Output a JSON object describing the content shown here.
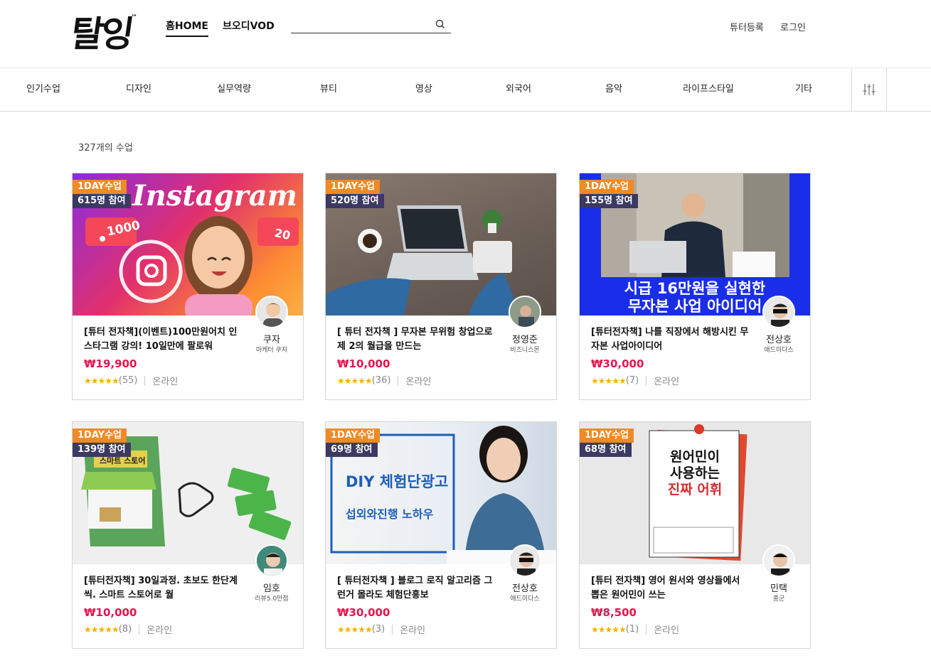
{
  "header": {
    "logo": "탈잉",
    "logo_tm": "™",
    "nav_home": "홈HOME",
    "nav_vod": "브오디VOD",
    "search_placeholder": "",
    "tutor_register": "튜터등록",
    "login": "로그인"
  },
  "categories": [
    "인기수업",
    "디자인",
    "실무역량",
    "뷰티",
    "영상",
    "외국어",
    "음악",
    "라이프스타일",
    "기타"
  ],
  "course_count": "327개의 수업",
  "cards": [
    {
      "badge_day": "1DAY수업",
      "participants": "615명 참여",
      "title": "[튜터 전자책](이벤트)100만원어치 인스타그램 강의! 10일만에 팔로워",
      "price": "₩19,900",
      "stars": "★★★★★",
      "reviews": "(55)",
      "mode": "온라인",
      "tutor": "쿠자",
      "tutor_sub": "마케터 쿠자",
      "thumb_text": "Instagram",
      "thumb_like": "1000",
      "thumb_heart": "20"
    },
    {
      "badge_day": "1DAY수업",
      "participants": "520명 참여",
      "title": "[ 튜터 전자책 ] 무자본 무위험 창업으로 제 2의 월급을 만드는",
      "price": "₩10,000",
      "stars": "★★★★★",
      "reviews": "(36)",
      "mode": "온라인",
      "tutor": "정영준",
      "tutor_sub": "비즈니스몬"
    },
    {
      "badge_day": "1DAY수업",
      "participants": "155명 참여",
      "title": "[튜터전자책] 나를 직장에서 해방시킨 무자본 사업아이디어",
      "price": "₩30,000",
      "stars": "★★★★★",
      "reviews": "(7)",
      "mode": "온라인",
      "tutor": "전상호",
      "tutor_sub": "애드미다스",
      "thumb_line1": "시급 16만원을 실현한",
      "thumb_line2": "무자본 사업 아이디어"
    },
    {
      "badge_day": "1DAY수업",
      "participants": "139명 참여",
      "title": "[튜터전자책] 30일과정. 초보도 한단계씩. 스마트 스토어로 월",
      "price": "₩10,000",
      "stars": "★★★★★",
      "reviews": "(8)",
      "mode": "온라인",
      "tutor": "임호",
      "tutor_sub": "리뷰5.0만점",
      "thumb_sign": "스마트 스토어"
    },
    {
      "badge_day": "1DAY수업",
      "participants": "69명 참여",
      "title": "[ 튜터전자책 ] 블로그 로직 알고리즘 그런거 몰라도 체험단홍보",
      "price": "₩30,000",
      "stars": "★★★★★",
      "reviews": "(3)",
      "mode": "온라인",
      "tutor": "전상호",
      "tutor_sub": "애드미다스",
      "thumb_line1": "DIY 체험단광고",
      "thumb_line2": "섭외와진행 노하우"
    },
    {
      "badge_day": "1DAY수업",
      "participants": "68명 참여",
      "title": "[튜터 전자책] 영어 원서와 영상들에서 뽑은 원어민이 쓰는",
      "price": "₩8,500",
      "stars": "★★★★★",
      "reviews": "(1)",
      "mode": "온라인",
      "tutor": "민택",
      "tutor_sub": "홍군",
      "thumb_line1": "원어민이",
      "thumb_line2": "사용하는",
      "thumb_line3": "진짜 어휘"
    }
  ],
  "colors": {
    "accent_price": "#e4164f",
    "badge_orange": "#f08a24",
    "badge_navy": "#3c3a63",
    "star": "#f3b300"
  }
}
